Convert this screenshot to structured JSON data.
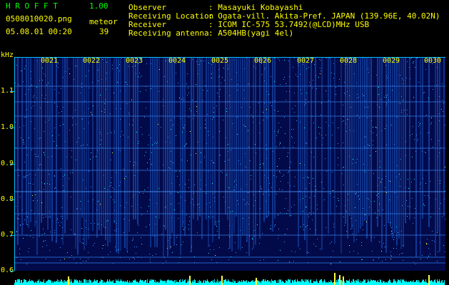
{
  "header": {
    "app_title": "H R O F F T",
    "version": "1.00",
    "filename": "0508010020.png",
    "timestamp": "05.08.01 00:20",
    "meteor_label": "meteor",
    "meteor_count": "39"
  },
  "info": {
    "observer_label": "Observer",
    "observer_value": ": Masayuki Kobayashi",
    "location_label": "Receiving Location",
    "location_value": ": Ogata-vill. Akita-Pref. JAPAN (139.96E, 40.02N)",
    "receiver_label": "Receiver",
    "receiver_value": ": ICOM IC-575 53.7492(@LCD)MHz USB",
    "antenna_label": "Receiving antenna",
    "antenna_value": ": A504HB(yagi 4el)"
  },
  "spectrogram": {
    "y_unit": "kHz",
    "y_ticks": [
      "1.1",
      "1.0",
      "0.9",
      "0.8",
      "0.7",
      "0.6"
    ],
    "time_labels": [
      "0021",
      "0022",
      "0023",
      "0024",
      "0025",
      "0026",
      "0027",
      "0028",
      "0029",
      "0030"
    ],
    "colors": {
      "background": "#020a4a",
      "noise": "#1e5fd0",
      "bright": "#00ffff",
      "hot": "#ffff40",
      "axis": "#00c0ff"
    }
  }
}
